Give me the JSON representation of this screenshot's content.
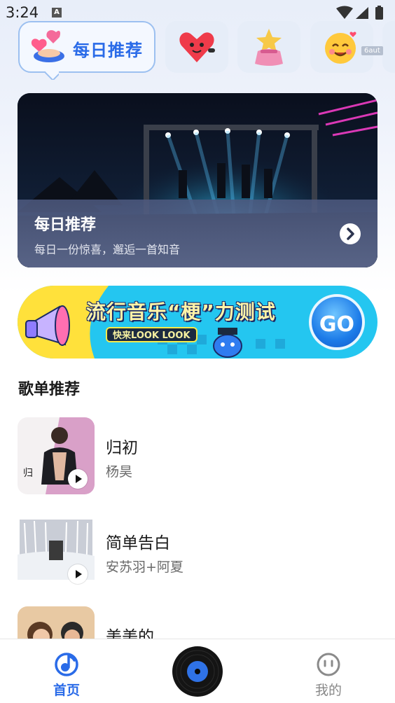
{
  "status_bar": {
    "time": "3:24",
    "notification_icon": "A"
  },
  "categories": {
    "main_label": "每日推荐",
    "tiles": [
      "heart-character-icon",
      "star-bag-icon",
      "smiling-face-icon"
    ],
    "badge": "6aut"
  },
  "featured": {
    "title": "每日推荐",
    "subtitle": "每日一份惊喜，邂逅一首知音"
  },
  "banner": {
    "title": "流行音乐“梗”力测试",
    "pill": "快来LOOK LOOK",
    "go_label": "GO"
  },
  "playlist": {
    "section_title": "歌单推荐",
    "songs": [
      {
        "title": "归初",
        "artist": "杨昊"
      },
      {
        "title": "简单告白",
        "artist": "安苏羽+阿夏"
      },
      {
        "title": "美美的",
        "artist": ""
      }
    ]
  },
  "nav": {
    "home_label": "首页",
    "mine_label": "我的"
  },
  "colors": {
    "accent": "#2a6be8",
    "banner": "#24c6f0"
  }
}
